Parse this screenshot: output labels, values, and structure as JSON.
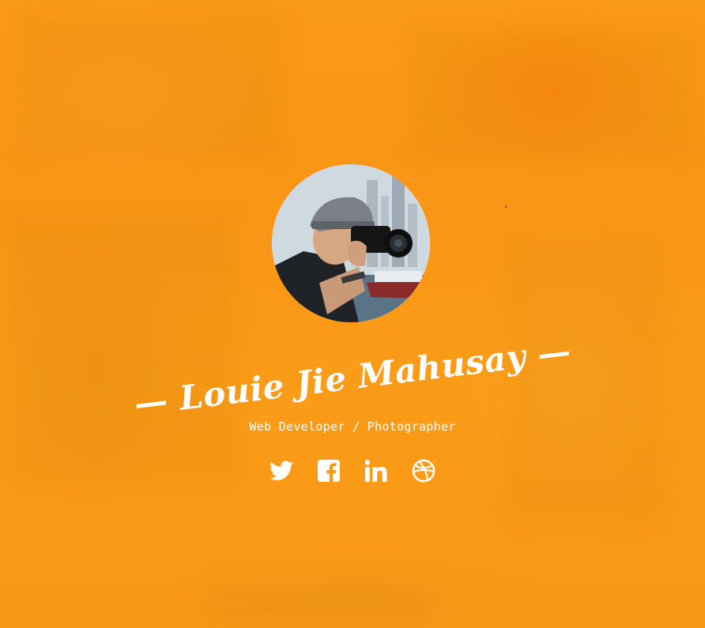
{
  "profile": {
    "name": "Louie Jie Mahusay",
    "name_display": "— Louie Jie Mahusay —",
    "subtitle": "Web Developer / Photographer",
    "avatar_alt": "Louie Jie Mahusay"
  },
  "socials": [
    {
      "name": "twitter",
      "icon": "twitter-icon"
    },
    {
      "name": "facebook",
      "icon": "facebook-icon"
    },
    {
      "name": "linkedin",
      "icon": "linkedin-icon"
    },
    {
      "name": "dribbble",
      "icon": "dribbble-icon"
    }
  ],
  "colors": {
    "background": "#f99a16",
    "text": "#ffffff"
  }
}
